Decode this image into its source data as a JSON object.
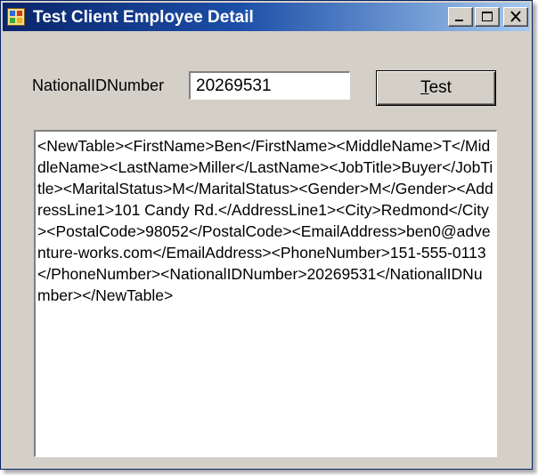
{
  "window": {
    "title": "Test Client Employee Detail",
    "minimize_label": "Minimize",
    "maximize_label": "Maximize",
    "close_label": "Close"
  },
  "form": {
    "id_label": "NationalIDNumber",
    "id_value": "20269531",
    "test_button_mnemonic": "T",
    "test_button_rest": "est",
    "result_text": "<NewTable><FirstName>Ben</FirstName><MiddleName>T</MiddleName><LastName>Miller</LastName><JobTitle>Buyer</JobTitle><MaritalStatus>M</MaritalStatus><Gender>M</Gender><AddressLine1>101 Candy Rd.</AddressLine1><City>Redmond</City><PostalCode>98052</PostalCode><EmailAddress>ben0@adventure-works.com</EmailAddress><PhoneNumber>151-555-0113</PhoneNumber><NationalIDNumber>20269531</NationalIDNumber></NewTable>"
  },
  "colors": {
    "titlebar_start": "#0a246a",
    "titlebar_end": "#a6caf0",
    "window_face": "#d4d0c8"
  },
  "icons": [
    "app-icon",
    "minimize-icon",
    "maximize-icon",
    "close-icon"
  ]
}
